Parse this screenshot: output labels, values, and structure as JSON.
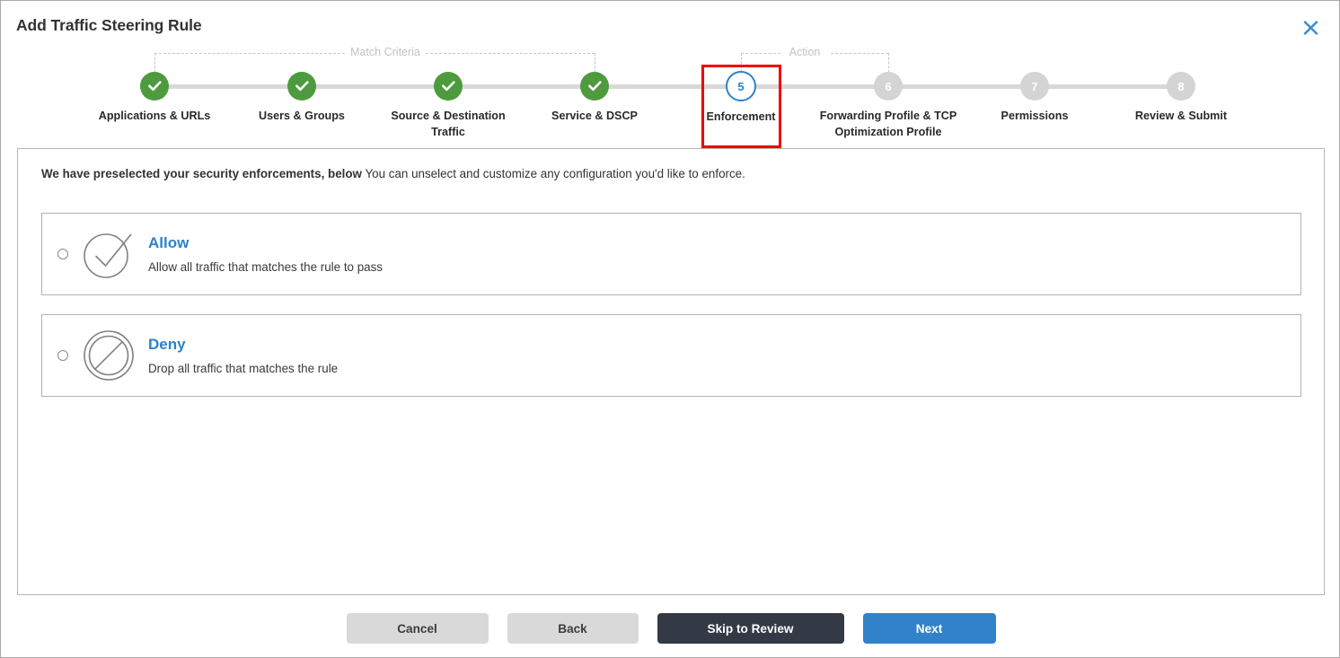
{
  "dialog": {
    "title": "Add Traffic Steering Rule",
    "close_icon": "close-icon"
  },
  "stepper": {
    "groups": [
      {
        "label": "Match Criteria",
        "start_step": 1,
        "end_step": 4
      },
      {
        "label": "Action",
        "start_step": 5,
        "end_step": 6
      }
    ],
    "current_step": 5,
    "steps": [
      {
        "number": "1",
        "label": "Applications & URLs",
        "state": "done"
      },
      {
        "number": "2",
        "label": "Users & Groups",
        "state": "done"
      },
      {
        "number": "3",
        "label": "Source & Destination Traffic",
        "state": "done"
      },
      {
        "number": "4",
        "label": "Service & DSCP",
        "state": "done"
      },
      {
        "number": "5",
        "label": "Enforcement",
        "state": "current"
      },
      {
        "number": "6",
        "label": "Forwarding Profile & TCP\nOptimization Profile",
        "state": "pending"
      },
      {
        "number": "7",
        "label": "Permissions",
        "state": "pending"
      },
      {
        "number": "8",
        "label": "Review & Submit",
        "state": "pending"
      }
    ]
  },
  "content": {
    "intro_bold": "We have preselected your security enforcements, below",
    "intro_rest": " You can unselect and customize any configuration you'd like to enforce.",
    "options": [
      {
        "title": "Allow",
        "description": "Allow all traffic that matches the rule to pass",
        "icon": "check-circle-icon",
        "selected": false
      },
      {
        "title": "Deny",
        "description": "Drop all traffic that matches the rule",
        "icon": "no-entry-icon",
        "selected": false
      }
    ]
  },
  "footer": {
    "cancel_label": "Cancel",
    "back_label": "Back",
    "skip_label": "Skip to Review",
    "next_label": "Next"
  },
  "colors": {
    "done_green": "#4e9a3e",
    "current_blue": "#2b82c9",
    "pending_gray": "#d4d4d4",
    "highlight_red": "#ee0000",
    "link_blue": "#2b82c9",
    "primary_btn": "#3182c9",
    "dark_btn": "#333a45"
  }
}
